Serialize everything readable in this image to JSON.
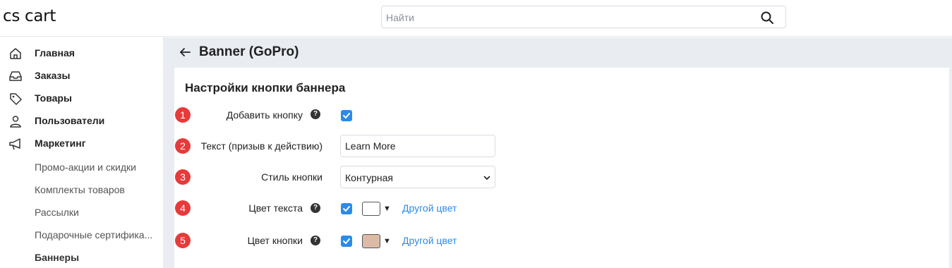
{
  "app": {
    "logo": "cs cart"
  },
  "search": {
    "placeholder": "Найти",
    "value": ""
  },
  "sidebar": {
    "items": [
      {
        "label": "Главная",
        "icon": "home-icon"
      },
      {
        "label": "Заказы",
        "icon": "inbox-icon"
      },
      {
        "label": "Товары",
        "icon": "tag-icon"
      },
      {
        "label": "Пользователи",
        "icon": "user-icon"
      },
      {
        "label": "Маркетинг",
        "icon": "megaphone-icon"
      }
    ],
    "marketing_sub": [
      {
        "label": "Промо-акции и скидки",
        "active": false
      },
      {
        "label": "Комплекты товаров",
        "active": false
      },
      {
        "label": "Рассылки",
        "active": false
      },
      {
        "label": "Подарочные сертифика...",
        "active": false
      },
      {
        "label": "Баннеры",
        "active": true
      }
    ]
  },
  "page": {
    "title": "Banner (GoPro)"
  },
  "section": {
    "title": "Настройки кнопки баннера"
  },
  "fields": {
    "add_button": {
      "badge": "1",
      "label": "Добавить кнопку",
      "help": "?",
      "checked": true
    },
    "cta_text": {
      "badge": "2",
      "label": "Текст (призыв к действию)",
      "value": "Learn More"
    },
    "button_style": {
      "badge": "3",
      "label": "Стиль кнопки",
      "value": "Контурная"
    },
    "text_color": {
      "badge": "4",
      "label": "Цвет текста",
      "help": "?",
      "checked": true,
      "swatch": "#ffffff",
      "caret": "▼",
      "link": "Другой цвет"
    },
    "button_color": {
      "badge": "5",
      "label": "Цвет кнопки",
      "help": "?",
      "checked": true,
      "swatch": "#dcbba6",
      "caret": "▼",
      "link": "Другой цвет"
    }
  },
  "colors": {
    "accent": "#2b8be8",
    "badge": "#e83a3a",
    "main_bg": "#e9edf2"
  }
}
